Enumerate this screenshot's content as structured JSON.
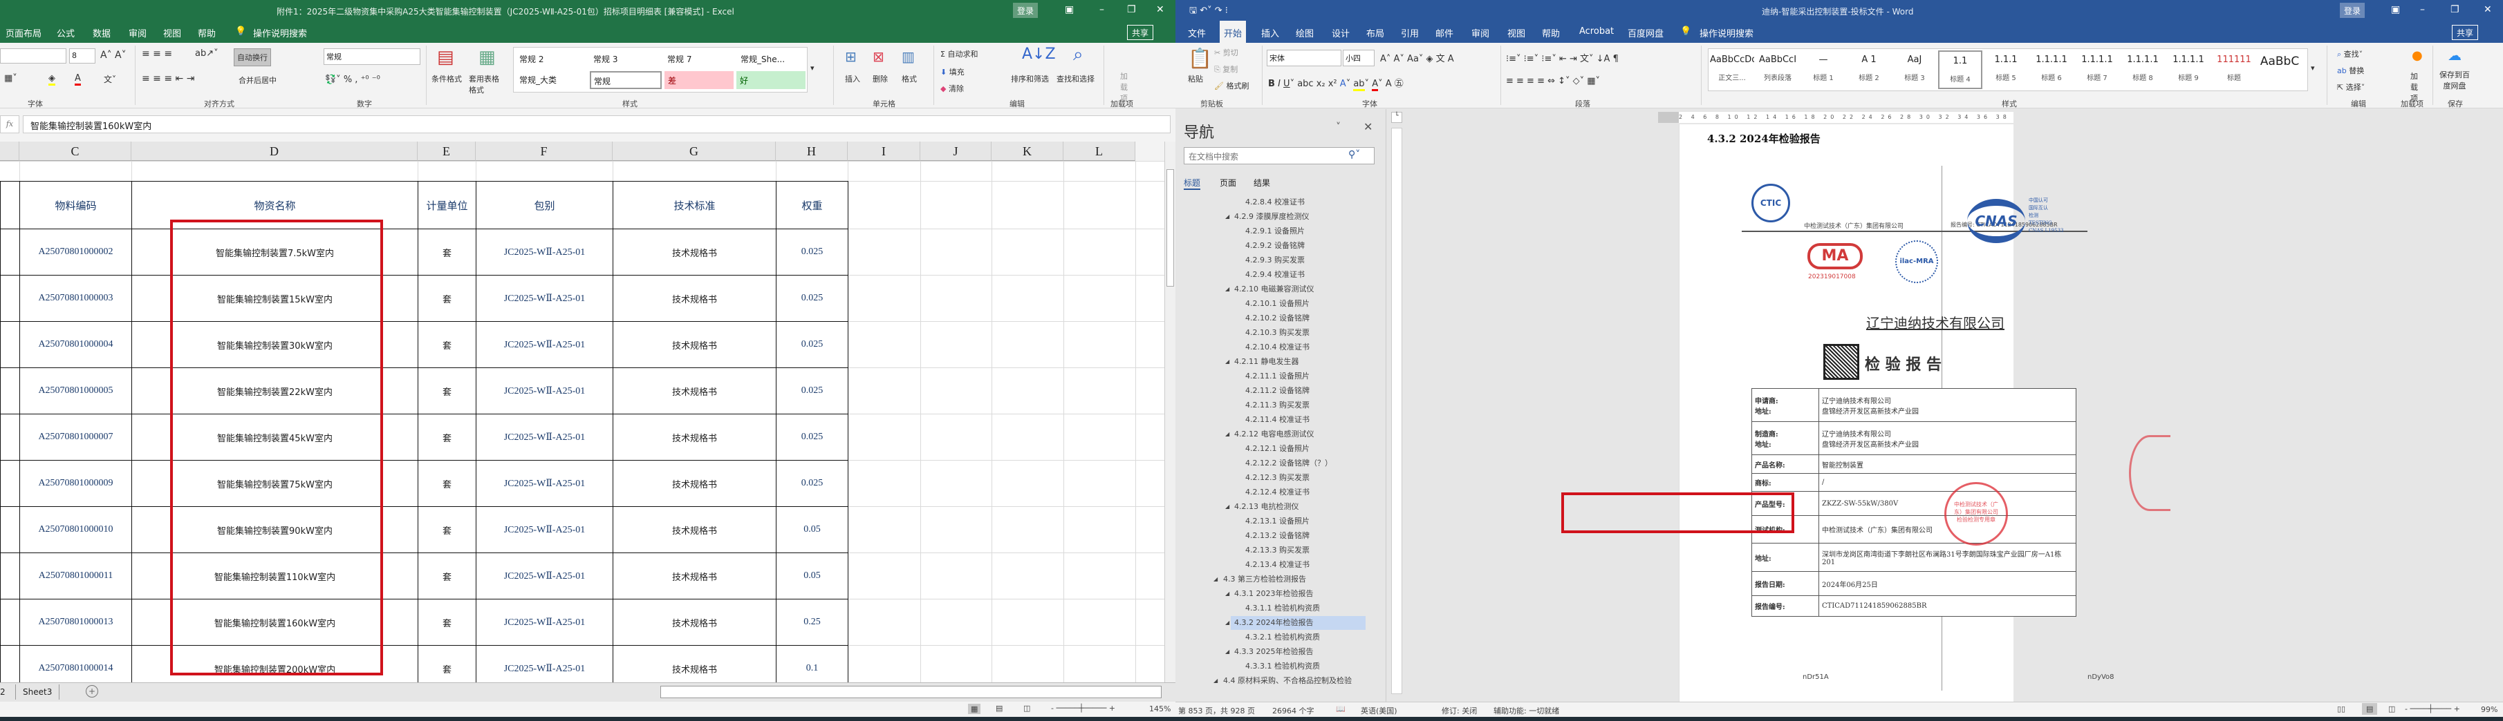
{
  "excel": {
    "title": "附件1：2025年二级物资集中采购A25大类智能集输控制装置（JC2025-WⅡ-A25-01包）招标项目明细表 [兼容模式] - Excel",
    "login": "登录",
    "share": "共享",
    "tabs": [
      "页面布局",
      "公式",
      "数据",
      "审阅",
      "视图",
      "帮助"
    ],
    "tell_me": "操作说明搜索",
    "ribbon": {
      "font_size": "8",
      "wrap_text": "自动换行",
      "merge_center": "合并后居中",
      "number_format": "常规",
      "conditional_format": "条件格式",
      "table_format": "套用表格格式",
      "styles": [
        "常规 2",
        "常规 3",
        "常规 7",
        "常规_She...",
        "常规_大类",
        "常规",
        "差",
        "好"
      ],
      "insert": "插入",
      "delete": "删除",
      "format": "格式",
      "autosum": "自动求和",
      "fill": "填充",
      "clear": "清除",
      "sort_filter": "排序和筛选",
      "find_select": "查找和选择",
      "addins": "加载项",
      "groups": [
        "字体",
        "对齐方式",
        "数字",
        "样式",
        "单元格",
        "编辑",
        "加载项"
      ]
    },
    "formula_bar": {
      "fx": "fx",
      "value": "智能集输控制装置160kW室内"
    },
    "columns": [
      "C",
      "D",
      "E",
      "F",
      "G",
      "H",
      "I",
      "J",
      "K",
      "L"
    ],
    "headers": [
      "物料编码",
      "物资名称",
      "计量单位",
      "包别",
      "技术标准",
      "权重"
    ],
    "rows": [
      [
        "A25070801000002",
        "智能集输控制装置7.5kW室内",
        "套",
        "JC2025-WⅡ-A25-01",
        "技术规格书",
        "0.025"
      ],
      [
        "A25070801000003",
        "智能集输控制装置15kW室内",
        "套",
        "JC2025-WⅡ-A25-01",
        "技术规格书",
        "0.025"
      ],
      [
        "A25070801000004",
        "智能集输控制装置30kW室内",
        "套",
        "JC2025-WⅡ-A25-01",
        "技术规格书",
        "0.025"
      ],
      [
        "A25070801000005",
        "智能集输控制装置22kW室内",
        "套",
        "JC2025-WⅡ-A25-01",
        "技术规格书",
        "0.025"
      ],
      [
        "A25070801000007",
        "智能集输控制装置45kW室内",
        "套",
        "JC2025-WⅡ-A25-01",
        "技术规格书",
        "0.025"
      ],
      [
        "A25070801000009",
        "智能集输控制装置75kW室内",
        "套",
        "JC2025-WⅡ-A25-01",
        "技术规格书",
        "0.025"
      ],
      [
        "A25070801000010",
        "智能集输控制装置90kW室内",
        "套",
        "JC2025-WⅡ-A25-01",
        "技术规格书",
        "0.05"
      ],
      [
        "A25070801000011",
        "智能集输控制装置110kW室内",
        "套",
        "JC2025-WⅡ-A25-01",
        "技术规格书",
        "0.05"
      ],
      [
        "A25070801000013",
        "智能集输控制装置160kW室内",
        "套",
        "JC2025-WⅡ-A25-01",
        "技术规格书",
        "0.25"
      ],
      [
        "A25070801000014",
        "智能集输控制装置200kW室内",
        "套",
        "JC2025-WⅡ-A25-01",
        "技术规格书",
        "0.1"
      ]
    ],
    "sheet_tabs": [
      "2",
      "Sheet3"
    ],
    "zoom": "145%",
    "highlight_color": "#d0121b"
  },
  "word": {
    "title": "迪纳-智能采出控制装置-投标文件 - Word",
    "login": "登录",
    "share": "共享",
    "tabs": [
      "文件",
      "开始",
      "插入",
      "绘图",
      "设计",
      "布局",
      "引用",
      "邮件",
      "审阅",
      "视图",
      "帮助",
      "Acrobat",
      "百度网盘"
    ],
    "tell_me": "操作说明搜索",
    "ribbon": {
      "paste": "粘贴",
      "cut": "剪切",
      "copy": "复制",
      "format_painter": "格式刷",
      "font": "宋体",
      "font_size": "小四",
      "style_previews": [
        "AaBbCcDdI",
        "AaBbCcI",
        "—",
        "A 1",
        "AaJ",
        "1.1",
        "1.1.1",
        "1.1.1.1",
        "1.1.1.1",
        "1.1.1.1",
        "1.1.1.1",
        "111111",
        "AaBbC"
      ],
      "style_names": [
        "正文三...",
        "列表段落",
        "标题 1",
        "标题 2",
        "标题 3",
        "标题 4",
        "标题 5",
        "标题 6",
        "标题 7",
        "标题 8",
        "标题 9",
        "标题",
        ""
      ],
      "find": "查找",
      "replace": "替换",
      "select": "选择",
      "addins": "加载项",
      "save_baidu": "保存到百度网盘",
      "groups": [
        "剪贴板",
        "字体",
        "段落",
        "样式",
        "编辑",
        "加载项",
        "保存"
      ]
    },
    "nav": {
      "title": "导航",
      "search_placeholder": "在文档中搜索",
      "tabs": [
        "标题",
        "页面",
        "结果"
      ],
      "items": [
        {
          "level": 3,
          "text": "4.2.8.4 校准证书"
        },
        {
          "level": 2,
          "text": "4.2.9 漆膜厚度检测仪"
        },
        {
          "level": 3,
          "text": "4.2.9.1 设备照片"
        },
        {
          "level": 3,
          "text": "4.2.9.2 设备铭牌"
        },
        {
          "level": 3,
          "text": "4.2.9.3 购买发票"
        },
        {
          "level": 3,
          "text": "4.2.9.4 校准证书"
        },
        {
          "level": 2,
          "text": "4.2.10 电磁兼容测试仪"
        },
        {
          "level": 3,
          "text": "4.2.10.1 设备照片"
        },
        {
          "level": 3,
          "text": "4.2.10.2 设备铭牌"
        },
        {
          "level": 3,
          "text": "4.2.10.3 购买发票"
        },
        {
          "level": 3,
          "text": "4.2.10.4 校准证书"
        },
        {
          "level": 2,
          "text": "4.2.11 静电发生器"
        },
        {
          "level": 3,
          "text": "4.2.11.1 设备照片"
        },
        {
          "level": 3,
          "text": "4.2.11.2 设备铭牌"
        },
        {
          "level": 3,
          "text": "4.2.11.3 购买发票"
        },
        {
          "level": 3,
          "text": "4.2.11.4 校准证书"
        },
        {
          "level": 2,
          "text": "4.2.12 电容电感测试仪"
        },
        {
          "level": 3,
          "text": "4.2.12.1 设备照片"
        },
        {
          "level": 3,
          "text": "4.2.12.2 设备铭牌（？）"
        },
        {
          "level": 3,
          "text": "4.2.12.3 购买发票"
        },
        {
          "level": 3,
          "text": "4.2.12.4 校准证书"
        },
        {
          "level": 2,
          "text": "4.2.13 电抗检测仪"
        },
        {
          "level": 3,
          "text": "4.2.13.1 设备照片"
        },
        {
          "level": 3,
          "text": "4.2.13.2 设备铭牌"
        },
        {
          "level": 3,
          "text": "4.2.13.3 购买发票"
        },
        {
          "level": 3,
          "text": "4.2.13.4 校准证书"
        },
        {
          "level": 1,
          "text": "4.3 第三方检验检测报告"
        },
        {
          "level": 2,
          "text": "4.3.1 2023年检验报告"
        },
        {
          "level": 3,
          "text": "4.3.1.1 检验机构资质"
        },
        {
          "level": 2,
          "text": "4.3.2 2024年检验报告",
          "selected": true
        },
        {
          "level": 3,
          "text": "4.3.2.1 检验机构资质"
        },
        {
          "level": 2,
          "text": "4.3.3 2025年检验报告"
        },
        {
          "level": 3,
          "text": "4.3.3.1 检验机构资质"
        },
        {
          "level": 1,
          "text": "4.4 原材料采购、不合格品控制及检验"
        }
      ]
    },
    "document": {
      "heading": "4.3.2 2024年检验报告",
      "lab_name": "中检测试技术（广东）集团有限公司",
      "report_no_header": "报告编号: CTICAD711241859062885BR",
      "ctic_logo": "CTIC",
      "cma_logo": "MA",
      "cma_no": "202319017008",
      "ilac_logo": "ilac-MRA",
      "cnas_logo": "CNAS",
      "cnas_text": [
        "中国认可",
        "国际互认",
        "检测",
        "TESTING",
        "CNAS L19533"
      ],
      "company": "辽宁迪纳技术有限公司",
      "report_title": "检 验 报 告",
      "table": [
        {
          "label": "申请商:\n地址:",
          "value": "辽宁迪纳技术有限公司\n盘锦经济开发区高新技术产业园"
        },
        {
          "label": "制造商:\n地址:",
          "value": "辽宁迪纳技术有限公司\n盘锦经济开发区高新技术产业园"
        },
        {
          "label": "产品名称:",
          "value": "智能控制装置"
        },
        {
          "label": "商标:",
          "value": "/"
        },
        {
          "label": "产品型号:",
          "value": "ZKZZ-SW-55kW/380V"
        },
        {
          "label": "测试机构:",
          "value": "中检测试技术（广东）集团有限公司"
        },
        {
          "label": "地址:",
          "value": "深圳市龙岗区南湾街道下李朗社区布澜路31号李朗国际珠宝产业园厂房一A1栋201"
        },
        {
          "label": "报告日期:",
          "value": "2024年06月25日"
        },
        {
          "label": "报告编号:",
          "value": "CTICAD711241859062885BR"
        }
      ],
      "stamp_text": "中检测试技术（广东）集团有限公司 检验检测专用章",
      "footer_left": "nDr51A",
      "footer_right": "nDyVo8"
    },
    "status": {
      "page": "第 853 页，共 928 页",
      "words": "26964 个字",
      "language": "英语(美国)",
      "track": "修订: 关闭",
      "accessibility": "辅助功能: 一切就绪",
      "zoom": "99%"
    }
  }
}
